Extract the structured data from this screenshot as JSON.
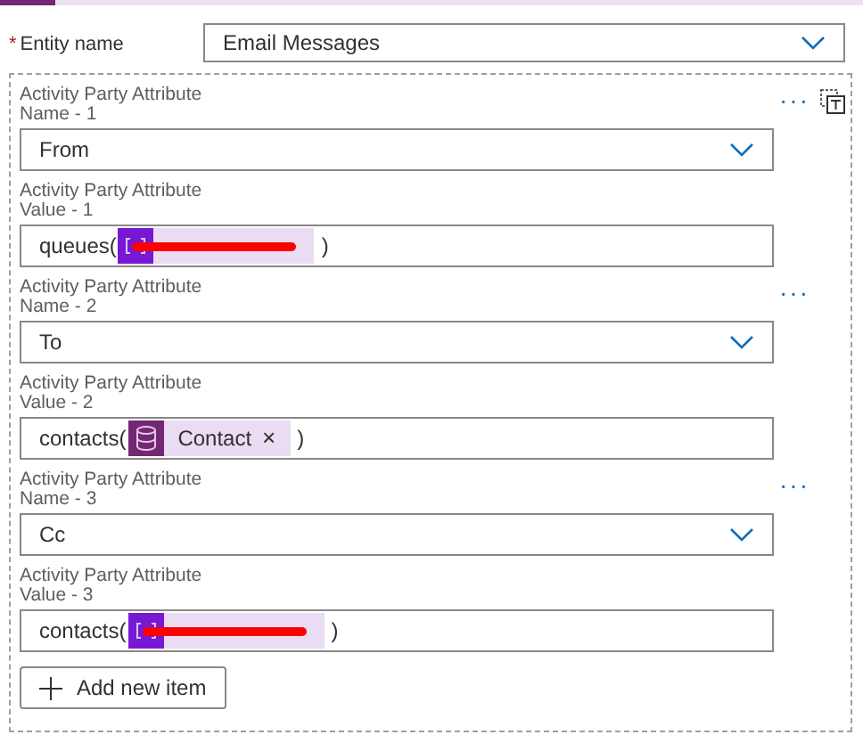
{
  "entity": {
    "label": "Entity name",
    "required_mark": "*",
    "value": "Email Messages"
  },
  "items": [
    {
      "name_label": "Activity Party Attribute Name - 1",
      "name_value": "From",
      "value_label": "Activity Party Attribute Value - 1",
      "value_prefix": "queues(",
      "token": {
        "kind": "variable",
        "redacted": true
      },
      "value_suffix": ")",
      "menu": "···",
      "copy_button": true
    },
    {
      "name_label": "Activity Party Attribute Name - 2",
      "name_value": "To",
      "value_label": "Activity Party Attribute Value - 2",
      "value_prefix": "contacts(",
      "token": {
        "kind": "table",
        "redacted": false,
        "label": "Contact",
        "remove": "×"
      },
      "value_suffix": ")",
      "menu": "···",
      "copy_button": false
    },
    {
      "name_label": "Activity Party Attribute Name - 3",
      "name_value": "Cc",
      "value_label": "Activity Party Attribute Value - 3",
      "value_prefix": "contacts(",
      "token": {
        "kind": "variable",
        "redacted": true
      },
      "value_suffix": ")",
      "menu": "···",
      "copy_button": false
    }
  ],
  "add_button": {
    "label": "Add new item"
  }
}
